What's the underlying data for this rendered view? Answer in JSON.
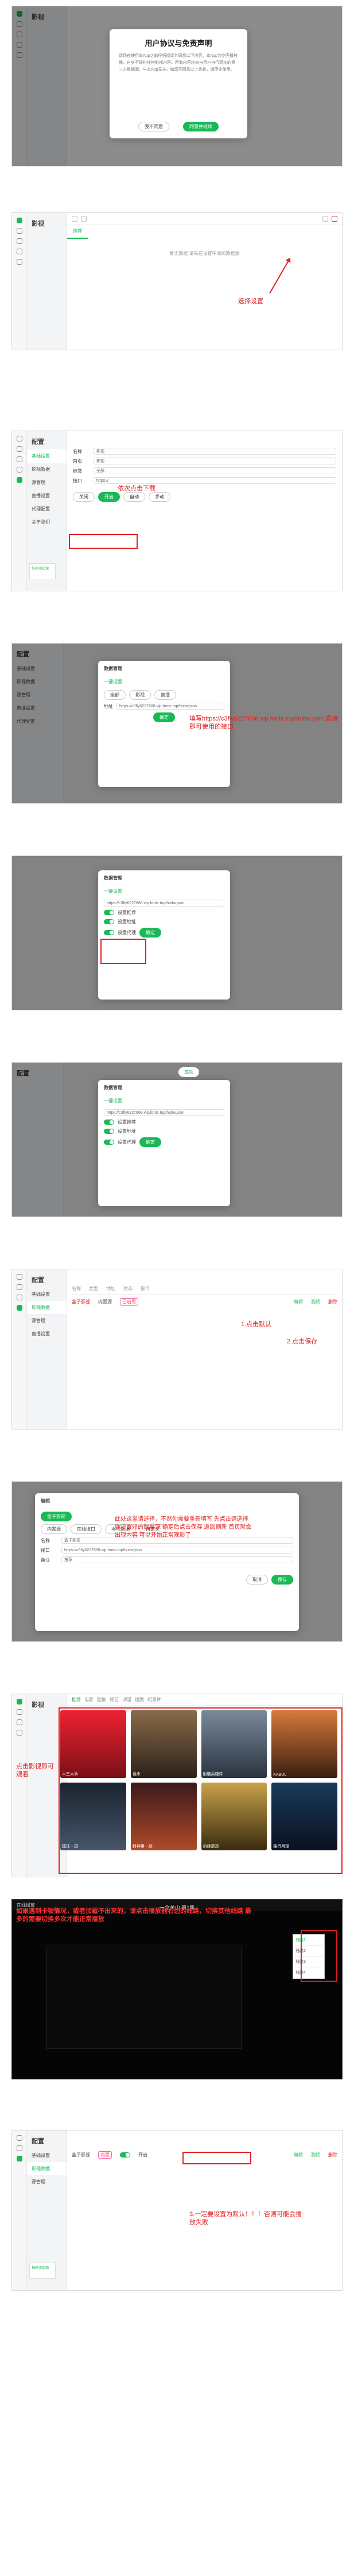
{
  "colors": {
    "accent": "#19b955",
    "annotation": "#e02020"
  },
  "step1": {
    "app_title": "影视",
    "dialog_title": "用户协议与免责声明",
    "dialog_body": "请您在使用本App之前仔细阅读并同意以下内容。本App为空壳播放器，自身不提供任何影视内容。所有内容均来自用户自行添加的第三方数据源，与本App无关。如您不同意以上条款，请停止使用。",
    "decline": "我不同意",
    "accept": "同意并继续"
  },
  "step2": {
    "app_title": "影视",
    "tab": "推荐",
    "empty_text": "暂无数据 请先在设置中添加数据源",
    "note": "选择设置"
  },
  "step3": {
    "side_title": "配置",
    "side_items": [
      "基础设置",
      "影视数据",
      "源管理",
      "直播设置",
      "代理配置",
      "关于我们"
    ],
    "fields": [
      {
        "label": "名称",
        "value": "影视"
      },
      {
        "label": "首页",
        "value": "影视"
      },
      {
        "label": "标签",
        "value": "全部"
      },
      {
        "label": "接口",
        "value": "https://"
      }
    ],
    "options": [
      "关闭",
      "开启",
      "自动",
      "手动"
    ],
    "note": "依次点击下载",
    "qr_label": "扫码添加"
  },
  "step4": {
    "dialog_title": "数据管理",
    "section": "一键设置",
    "tabs": [
      "全部",
      "影视",
      "直播"
    ],
    "address_label": "地址",
    "address_value": "https://c3fly6227668.vip.fonts.top/huitw.json",
    "confirm": "确定",
    "note": "填写https://c3fly6227668.vip.fonts.top/huitw.json 直接即可使用的接口"
  },
  "step5": {
    "dialog_title": "数据管理",
    "section": "一键设置",
    "address_value": "https://c3fly6227668.vip.fonts.top/huitw.json",
    "items": [
      "设置推荐",
      "设置地址",
      "设置代理"
    ],
    "confirm": "确定"
  },
  "step6": {
    "dialog_title": "数据管理",
    "section": "一键设置",
    "address_value": "https://c3fly6227668.vip.fonts.top/huitw.json",
    "items": [
      "设置推荐",
      "设置地址",
      "设置代理"
    ],
    "toast": "成功",
    "confirm": "确定"
  },
  "step7": {
    "side_title": "配置",
    "columns": [
      "名称",
      "类型",
      "地址",
      "状态",
      "操作"
    ],
    "row": {
      "name": "盒子影视",
      "type": "内置源",
      "status": "已启用"
    },
    "actions": [
      "编辑",
      "测试",
      "删除"
    ],
    "note1": "1.点击默认",
    "note2": "2.点击保存"
  },
  "step8": {
    "dialog_title": "编辑",
    "source_name": "盒子影视",
    "types": [
      "内置源",
      "在线接口",
      "本地数据",
      "自定义"
    ],
    "fields": [
      {
        "label": "名称",
        "value": "盒子影视"
      },
      {
        "label": "接口",
        "value": "https://c3fly6227668.vip.fonts.top/huitw.json"
      },
      {
        "label": "备注",
        "value": "推荐"
      }
    ],
    "confirm": "保存",
    "cancel": "取消",
    "note": "此处这里请选择，不然你需要重新填写 先点击请选择你设置好的数据源 确定后点击保存 返回刷新 首页就会出现内容 可以开始正常观影了"
  },
  "step9": {
    "app_title": "影视",
    "tabs": [
      "推荐",
      "电影",
      "剧集",
      "综艺",
      "动漫",
      "短剧",
      "纪录片"
    ],
    "movies": [
      "人生大事",
      "误杀",
      "射雕英雄传",
      "KABUL",
      "孤注一掷",
      "封神第一部",
      "热辣滚烫",
      "独行月球"
    ],
    "note": "点击影视即可观看"
  },
  "step10": {
    "window_title": "在线播放",
    "player_title": "一念关山 第1集",
    "lines": [
      "线路1",
      "线路2",
      "线路3",
      "线路4"
    ],
    "note": "如果遇到卡顿情况，或者加载不出来的，请点击播放器右边的线路，切换其他线路 最多的需要切换多次才能正常播放"
  },
  "step11": {
    "side_title": "配置",
    "row": {
      "name": "盒子影视",
      "type": "内置",
      "status": "开启"
    },
    "actions": [
      "编辑",
      "测试",
      "删除"
    ],
    "note": "3.一定要设置为默认！！！否则可能会播放失败"
  },
  "qr_text": "扫码添加源",
  "version": "v1.0.6"
}
